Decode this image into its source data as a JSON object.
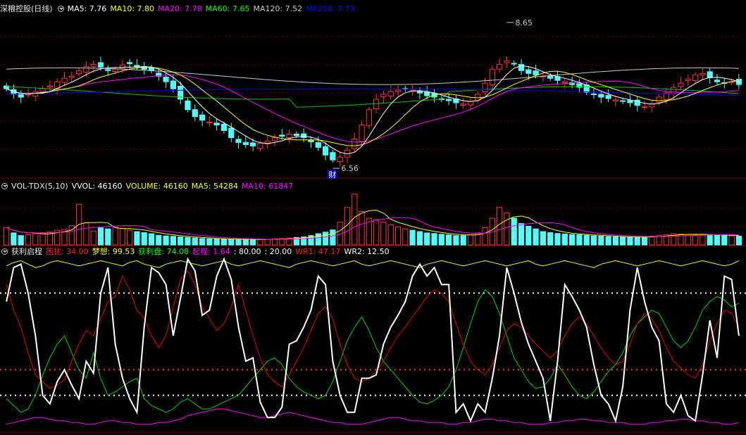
{
  "panels": {
    "price": {
      "title": "深粮控股(日线)",
      "ma": [
        {
          "label": "MA5: 7.76",
          "color": "#ffffff"
        },
        {
          "label": "MA10: 7.80",
          "color": "#ffff00"
        },
        {
          "label": "MA20: 7.78",
          "color": "#ff00ff"
        },
        {
          "label": "MA60: 7.65",
          "color": "#00ff00"
        },
        {
          "label": "MA120: 7.52",
          "color": "#c8c8c8"
        },
        {
          "label": "MA250: 7.73",
          "color": "#0000ff"
        }
      ]
    },
    "volume": {
      "title": "VOL-TDX(5,10)",
      "items": [
        {
          "label": "VVOL: 46160",
          "color": "#ffffff"
        },
        {
          "label": "VOLUME: 46160",
          "color": "#ffff00"
        },
        {
          "label": "MA5: 54284",
          "color": "#ffff00"
        },
        {
          "label": "MA10: 61847",
          "color": "#ff00ff"
        }
      ]
    },
    "indicator": {
      "title": "获利启程",
      "items": [
        {
          "label": "困扰: 34.00",
          "color": "#ff2020"
        },
        {
          "label": "梦想: 99.53",
          "color": "#ffff00"
        },
        {
          "label": "获利盘: 74.08",
          "color": "#00ff00"
        },
        {
          "label": "起程: 1.64",
          "color": "#ff00ff"
        },
        {
          "label": ": 80.00",
          "color": "#ffffff"
        },
        {
          "label": ": 20.00",
          "color": "#ffffff"
        },
        {
          "label": "WR1: 47.17",
          "color": "#ff2020"
        },
        {
          "label": "WR2: 12.50",
          "color": "#ffffff"
        }
      ]
    }
  },
  "chart_data": {
    "type": "candlestick",
    "high_label": "8.65",
    "low_label": "6.56",
    "event_label": "财",
    "closes": [
      7.7,
      7.62,
      7.58,
      7.62,
      7.66,
      7.7,
      7.74,
      7.8,
      7.85,
      7.88,
      7.96,
      8.02,
      8.05,
      8.01,
      7.96,
      7.98,
      8.04,
      8.06,
      8.02,
      7.98,
      7.96,
      7.88,
      7.8,
      7.7,
      7.55,
      7.4,
      7.3,
      7.25,
      7.22,
      7.18,
      7.1,
      7.0,
      6.93,
      6.9,
      6.88,
      6.92,
      6.95,
      7.0,
      7.02,
      7.05,
      7.03,
      7.0,
      6.94,
      6.86,
      6.75,
      6.68,
      6.72,
      6.82,
      6.98,
      7.18,
      7.4,
      7.55,
      7.62,
      7.66,
      7.68,
      7.7,
      7.68,
      7.64,
      7.6,
      7.58,
      7.55,
      7.53,
      7.5,
      7.48,
      7.52,
      7.62,
      7.78,
      7.98,
      8.05,
      8.1,
      8.06,
      7.96,
      7.92,
      7.9,
      7.88,
      7.85,
      7.82,
      7.8,
      7.76,
      7.72,
      7.65,
      7.62,
      7.58,
      7.56,
      7.54,
      7.52,
      7.5,
      7.46,
      7.44,
      7.48,
      7.58,
      7.64,
      7.72,
      7.78,
      7.84,
      7.9,
      7.92,
      7.86,
      7.8,
      7.78,
      7.8,
      7.76
    ],
    "volumes": [
      6.5,
      4.5,
      3.5,
      3.8,
      4.2,
      4.6,
      4.8,
      5.5,
      5.8,
      7.2,
      15.2,
      8.2,
      5.2,
      6.4,
      6.0,
      6.6,
      6.2,
      5.5,
      5.0,
      4.6,
      4.2,
      3.6,
      3.4,
      3.2,
      3.0,
      2.8,
      2.6,
      2.4,
      2.3,
      2.2,
      2.1,
      2.0,
      2.0,
      2.1,
      2.2,
      2.0,
      2.1,
      2.3,
      2.4,
      2.6,
      2.8,
      3.0,
      3.5,
      4.2,
      4.8,
      5.6,
      8.5,
      14.0,
      19.0,
      12.5,
      10.0,
      9.5,
      8.5,
      7.5,
      6.8,
      6.0,
      5.5,
      5.0,
      4.5,
      4.3,
      4.0,
      3.8,
      3.5,
      3.5,
      3.8,
      4.5,
      6.5,
      10.0,
      14.0,
      12.0,
      10.0,
      8.0,
      7.0,
      6.0,
      5.0,
      4.6,
      4.3,
      4.1,
      3.9,
      3.8,
      3.6,
      3.4,
      3.3,
      3.1,
      3.0,
      2.9,
      2.8,
      2.9,
      3.1,
      3.3,
      3.6,
      3.9,
      4.2,
      4.1,
      3.9,
      3.8,
      3.9,
      3.8,
      3.6,
      3.5,
      3.4,
      3.3
    ],
    "indicator_white": [
      75,
      95,
      97,
      80,
      55,
      20,
      15,
      28,
      35,
      26,
      18,
      40,
      33,
      80,
      95,
      50,
      30,
      18,
      10,
      60,
      95,
      92,
      85,
      55,
      77,
      100,
      93,
      67,
      70,
      90,
      100,
      88,
      60,
      40,
      42,
      16,
      7,
      7,
      13,
      50,
      52,
      60,
      70,
      90,
      85,
      40,
      20,
      10,
      10,
      30,
      30,
      32,
      50,
      60,
      67,
      75,
      90,
      97,
      90,
      95,
      85,
      85,
      10,
      15,
      5,
      15,
      10,
      30,
      55,
      95,
      80,
      63,
      50,
      40,
      30,
      5,
      40,
      85,
      78,
      70,
      60,
      38,
      20,
      15,
      5,
      25,
      70,
      95,
      75,
      60,
      52,
      15,
      10,
      20,
      8,
      5,
      32,
      64,
      42,
      90,
      88,
      55
    ],
    "indicator_red": [
      85,
      70,
      60,
      45,
      32,
      28,
      24,
      26,
      29,
      40,
      50,
      58,
      55,
      65,
      75,
      78,
      90,
      82,
      70,
      65,
      55,
      48,
      55,
      72,
      88,
      93,
      85,
      72,
      65,
      58,
      62,
      72,
      85,
      70,
      55,
      42,
      32,
      28,
      25,
      32,
      40,
      48,
      58,
      68,
      72,
      65,
      50,
      38,
      30,
      28,
      30,
      34,
      40,
      48,
      55,
      60,
      66,
      72,
      78,
      82,
      80,
      75,
      62,
      50,
      40,
      35,
      32,
      38,
      48,
      58,
      62,
      60,
      55,
      50,
      46,
      42,
      46,
      55,
      62,
      66,
      62,
      55,
      48,
      42,
      38,
      40,
      50,
      62,
      68,
      65,
      58,
      48,
      40,
      36,
      32,
      30,
      38,
      52,
      62,
      70,
      68,
      60
    ],
    "indicator_green": [
      18,
      14,
      10,
      12,
      20,
      32,
      42,
      50,
      55,
      45,
      35,
      30,
      45,
      30,
      20,
      22,
      25,
      28,
      30,
      18,
      14,
      12,
      10,
      12,
      16,
      18,
      15,
      12,
      12,
      14,
      16,
      18,
      20,
      25,
      30,
      35,
      40,
      42,
      38,
      30,
      25,
      22,
      20,
      18,
      20,
      28,
      40,
      52,
      60,
      66,
      58,
      48,
      40,
      35,
      30,
      25,
      20,
      16,
      15,
      17,
      20,
      25,
      35,
      48,
      62,
      75,
      82,
      78,
      68,
      55,
      42,
      35,
      28,
      24,
      25,
      30,
      38,
      32,
      25,
      20,
      18,
      22,
      28,
      34,
      38,
      45,
      55,
      62,
      66,
      70,
      68,
      60,
      52,
      48,
      52,
      60,
      70,
      75,
      78,
      76,
      72,
      74
    ],
    "indicator_yellow": [
      96,
      98,
      99,
      97,
      95,
      96,
      98,
      99,
      98,
      97,
      96,
      97,
      98,
      99,
      98,
      97,
      96,
      98,
      99,
      97,
      96,
      95,
      97,
      98,
      99,
      98,
      97,
      96,
      97,
      98,
      99,
      97,
      96,
      97,
      98,
      99,
      98,
      97,
      96,
      95,
      97,
      98,
      99,
      98,
      97,
      96,
      97,
      98,
      99,
      97,
      96,
      97,
      98,
      99,
      98,
      97,
      96,
      95,
      97,
      98,
      99,
      98,
      97,
      96,
      97,
      98,
      99,
      98,
      97,
      96,
      97,
      98,
      99,
      97,
      96,
      97,
      98,
      99,
      98,
      97,
      96,
      95,
      97,
      98,
      99,
      98,
      97,
      96,
      97,
      98,
      99,
      98,
      97,
      96,
      97,
      98,
      99,
      98,
      97,
      96,
      97,
      99
    ],
    "indicator_magenta": [
      3,
      4,
      5,
      6,
      7,
      7,
      6,
      5,
      5,
      4,
      4,
      3,
      3,
      4,
      5,
      5,
      4,
      4,
      3,
      3,
      3,
      4,
      4,
      5,
      6,
      8,
      9,
      10,
      11,
      12,
      12,
      11,
      10,
      9,
      8,
      7,
      7,
      8,
      9,
      10,
      9,
      8,
      7,
      6,
      5,
      4,
      4,
      3,
      3,
      3,
      4,
      5,
      6,
      7,
      7,
      6,
      5,
      5,
      4,
      4,
      4,
      3,
      3,
      4,
      4,
      5,
      6,
      6,
      5,
      5,
      4,
      4,
      3,
      3,
      3,
      4,
      4,
      5,
      5,
      6,
      6,
      5,
      5,
      4,
      4,
      4,
      3,
      3,
      3,
      4,
      4,
      5,
      5,
      6,
      6,
      5,
      5,
      4,
      4,
      3,
      3,
      4
    ],
    "indicator_levels": [
      80,
      20
    ]
  }
}
